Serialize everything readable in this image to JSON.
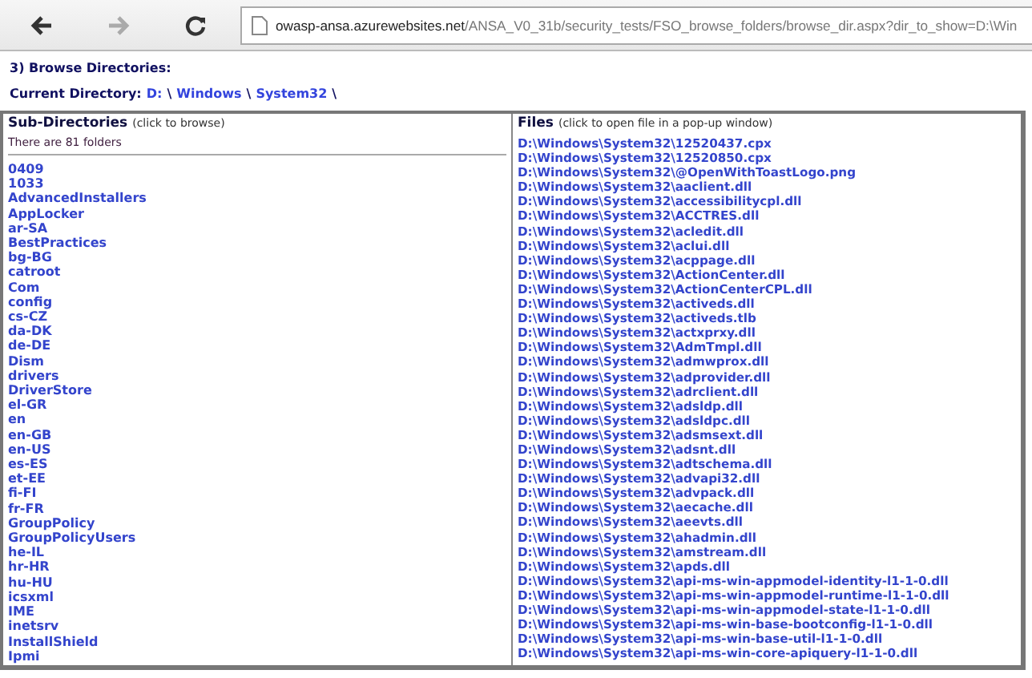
{
  "address_bar": {
    "host": "owasp-ansa.azurewebsites.net",
    "path": "/ANSA_V0_31b/security_tests/FSO_browse_folders/browse_dir.aspx?dir_to_show=D:\\Win"
  },
  "heading": "3) Browse Directories:",
  "current_directory": {
    "label": "Current Directory:",
    "segments": [
      {
        "kind": "link",
        "text": "D:"
      },
      {
        "kind": "sep",
        "text": "\\"
      },
      {
        "kind": "link",
        "text": "Windows"
      },
      {
        "kind": "sep",
        "text": "\\"
      },
      {
        "kind": "link",
        "text": "System32"
      },
      {
        "kind": "sep",
        "text": "\\"
      }
    ]
  },
  "sub_directories": {
    "title": "Sub-Directories",
    "hint": "(click to browse)",
    "count": "There are 81 folders",
    "items": [
      "0409",
      "1033",
      "AdvancedInstallers",
      "AppLocker",
      "ar-SA",
      "BestPractices",
      "bg-BG",
      "catroot",
      "Com",
      "config",
      "cs-CZ",
      "da-DK",
      "de-DE",
      "Dism",
      "drivers",
      "DriverStore",
      "el-GR",
      "en",
      "en-GB",
      "en-US",
      "es-ES",
      "et-EE",
      "fi-FI",
      "fr-FR",
      "GroupPolicy",
      "GroupPolicyUsers",
      "he-IL",
      "hr-HR",
      "hu-HU",
      "icsxml",
      "IME",
      "inetsrv",
      "InstallShield",
      "Ipmi"
    ]
  },
  "files": {
    "title": "Files",
    "hint": "(click to open file in a pop-up window)",
    "items": [
      "D:\\Windows\\System32\\12520437.cpx",
      "D:\\Windows\\System32\\12520850.cpx",
      "D:\\Windows\\System32\\@OpenWithToastLogo.png",
      "D:\\Windows\\System32\\aaclient.dll",
      "D:\\Windows\\System32\\accessibilitycpl.dll",
      "D:\\Windows\\System32\\ACCTRES.dll",
      "D:\\Windows\\System32\\acledit.dll",
      "D:\\Windows\\System32\\aclui.dll",
      "D:\\Windows\\System32\\acppage.dll",
      "D:\\Windows\\System32\\ActionCenter.dll",
      "D:\\Windows\\System32\\ActionCenterCPL.dll",
      "D:\\Windows\\System32\\activeds.dll",
      "D:\\Windows\\System32\\activeds.tlb",
      "D:\\Windows\\System32\\actxprxy.dll",
      "D:\\Windows\\System32\\AdmTmpl.dll",
      "D:\\Windows\\System32\\admwprox.dll",
      "D:\\Windows\\System32\\adprovider.dll",
      "D:\\Windows\\System32\\adrclient.dll",
      "D:\\Windows\\System32\\adsldp.dll",
      "D:\\Windows\\System32\\adsldpc.dll",
      "D:\\Windows\\System32\\adsmsext.dll",
      "D:\\Windows\\System32\\adsnt.dll",
      "D:\\Windows\\System32\\adtschema.dll",
      "D:\\Windows\\System32\\advapi32.dll",
      "D:\\Windows\\System32\\advpack.dll",
      "D:\\Windows\\System32\\aecache.dll",
      "D:\\Windows\\System32\\aeevts.dll",
      "D:\\Windows\\System32\\ahadmin.dll",
      "D:\\Windows\\System32\\amstream.dll",
      "D:\\Windows\\System32\\apds.dll",
      "D:\\Windows\\System32\\api-ms-win-appmodel-identity-l1-1-0.dll",
      "D:\\Windows\\System32\\api-ms-win-appmodel-runtime-l1-1-0.dll",
      "D:\\Windows\\System32\\api-ms-win-appmodel-state-l1-1-0.dll",
      "D:\\Windows\\System32\\api-ms-win-base-bootconfig-l1-1-0.dll",
      "D:\\Windows\\System32\\api-ms-win-base-util-l1-1-0.dll",
      "D:\\Windows\\System32\\api-ms-win-core-apiquery-l1-1-0.dll"
    ]
  }
}
